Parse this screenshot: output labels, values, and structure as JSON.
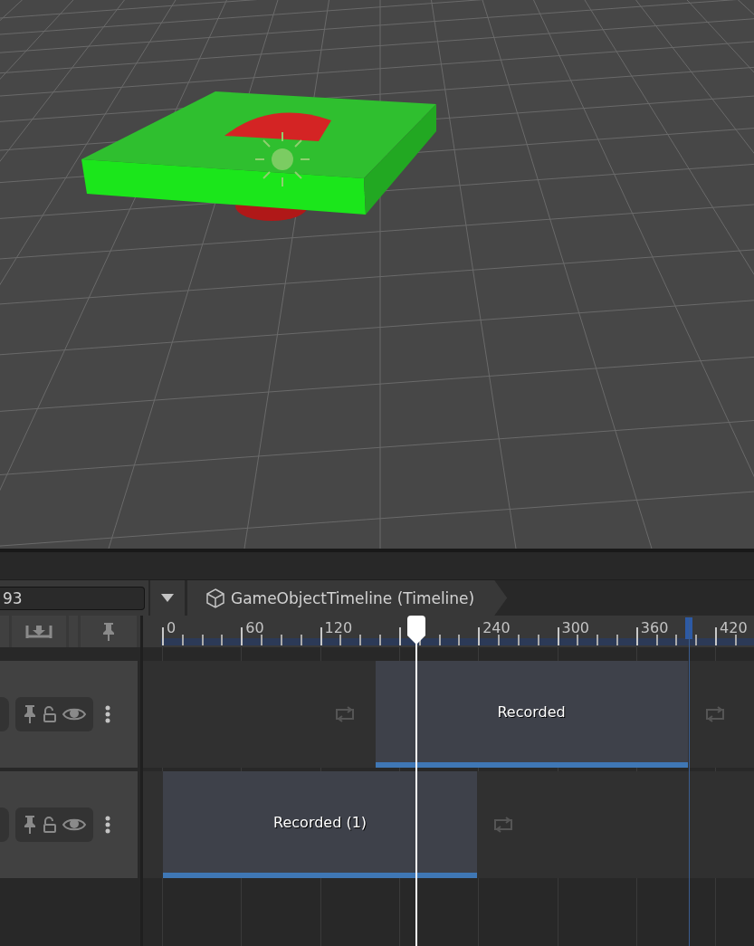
{
  "toolbar": {
    "frame_field": {
      "value": "93"
    },
    "breadcrumb": "GameObjectTimeline (Timeline)"
  },
  "ruler": {
    "labels": [
      "0",
      "60",
      "120",
      "240",
      "300",
      "360",
      "420"
    ]
  },
  "tracks": [
    {
      "clip": "Recorded"
    },
    {
      "clip": "Recorded (1)"
    }
  ]
}
